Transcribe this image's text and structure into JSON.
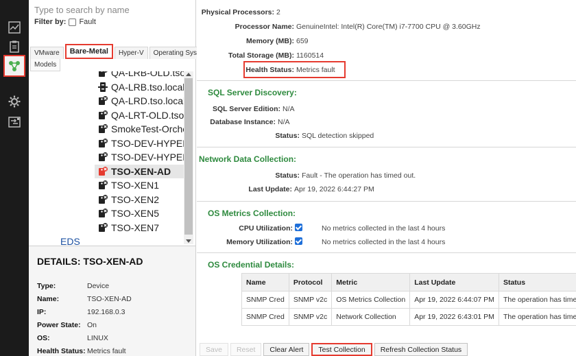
{
  "rail": {
    "icons": [
      "chart-icon",
      "clipboard-icon",
      "network-icon",
      "gear-icon",
      "transfer-icon"
    ]
  },
  "navigation": {
    "search_placeholder": "Type to search by name",
    "filter_label": "Filter by:",
    "filter_option": "Fault",
    "tabs": [
      {
        "label": "VMware",
        "active": false
      },
      {
        "label": "Bare-Metal",
        "active": true
      },
      {
        "label": "Hyper-V",
        "active": false
      },
      {
        "label": "Operating Systems",
        "active": false
      }
    ],
    "tab_models": "Models",
    "tree_items": [
      {
        "label": "QA-LRB-OLD.tso.lo",
        "icon": "fault-server-icon"
      },
      {
        "label": "QA-LRB.tso.local",
        "icon": "server-icon"
      },
      {
        "label": "QA-LRD.tso.local",
        "icon": "fault-server-icon"
      },
      {
        "label": "QA-LRT-OLD.tso.lc",
        "icon": "fault-server-icon"
      },
      {
        "label": "SmokeTest-Orches",
        "icon": "fault-server-icon"
      },
      {
        "label": "TSO-DEV-HYPERV",
        "icon": "fault-server-icon"
      },
      {
        "label": "TSO-DEV-HYPERV",
        "icon": "fault-server-icon"
      },
      {
        "label": "TSO-XEN-AD",
        "icon": "fault-server-icon-red",
        "selected": true
      },
      {
        "label": "TSO-XEN1",
        "icon": "fault-server-icon"
      },
      {
        "label": "TSO-XEN2",
        "icon": "fault-server-icon"
      },
      {
        "label": "TSO-XEN5",
        "icon": "fault-server-icon"
      },
      {
        "label": "TSO-XEN7",
        "icon": "fault-server-icon"
      }
    ],
    "eds_label": "EDS"
  },
  "details": {
    "title": "DETAILS: TSO-XEN-AD",
    "rows": [
      {
        "key": "Type:",
        "value": "Device"
      },
      {
        "key": "Name:",
        "value": "TSO-XEN-AD"
      },
      {
        "key": "IP:",
        "value": "192.168.0.3"
      },
      {
        "key": "Power State:",
        "value": "On"
      },
      {
        "key": "OS:",
        "value": "LINUX"
      },
      {
        "key": "Health Status:",
        "value": "Metrics fault"
      }
    ]
  },
  "main": {
    "physical_processors": {
      "key": "Physical Processors:",
      "value": "2"
    },
    "processor_name": {
      "key": "Processor Name:",
      "value": "GenuineIntel: Intel(R) Core(TM) i7-7700 CPU @ 3.60GHz"
    },
    "memory": {
      "key": "Memory (MB):",
      "value": "659"
    },
    "total_storage": {
      "key": "Total Storage (MB):",
      "value": "1160514"
    },
    "health_status": {
      "key": "Health Status:",
      "value": "Metrics fault"
    },
    "sql": {
      "title": "SQL Server Discovery:",
      "edition": {
        "key": "SQL Server Edition:",
        "value": "N/A"
      },
      "instance": {
        "key": "Database Instance:",
        "value": "N/A"
      },
      "status": {
        "key": "Status:",
        "value": "SQL detection skipped"
      }
    },
    "network": {
      "title": "Network Data Collection:",
      "status": {
        "key": "Status:",
        "value": "Fault - The operation has timed out."
      },
      "last_update": {
        "key": "Last Update:",
        "value": "Apr 19, 2022 6:44:27 PM"
      }
    },
    "os_metrics": {
      "title": "OS Metrics Collection:",
      "cpu": {
        "key": "CPU Utilization:",
        "checked": true,
        "note": "No metrics collected in the last 4 hours"
      },
      "memory": {
        "key": "Memory Utilization:",
        "checked": true,
        "note": "No metrics collected in the last 4 hours"
      }
    },
    "credentials": {
      "title": "OS Credential Details:",
      "columns": [
        "Name",
        "Protocol",
        "Metric",
        "Last Update",
        "Status"
      ],
      "rows": [
        [
          "SNMP Cred",
          "SNMP v2c",
          "OS Metrics Collection",
          "Apr 19, 2022 6:44:07 PM",
          "The operation has timed out."
        ],
        [
          "SNMP Cred",
          "SNMP v2c",
          "Network Collection",
          "Apr 19, 2022 6:43:01 PM",
          "The operation has timed out."
        ]
      ]
    },
    "buttons": {
      "save": "Save",
      "reset": "Reset",
      "clear_alert": "Clear Alert",
      "test_collection": "Test Collection",
      "refresh_status": "Refresh Collection Status"
    }
  },
  "colors": {
    "highlight": "#e53a2f",
    "section_title": "#2e8a3e",
    "rail_bg": "#1b1b1b",
    "checkbox": "#1e6fd9"
  }
}
